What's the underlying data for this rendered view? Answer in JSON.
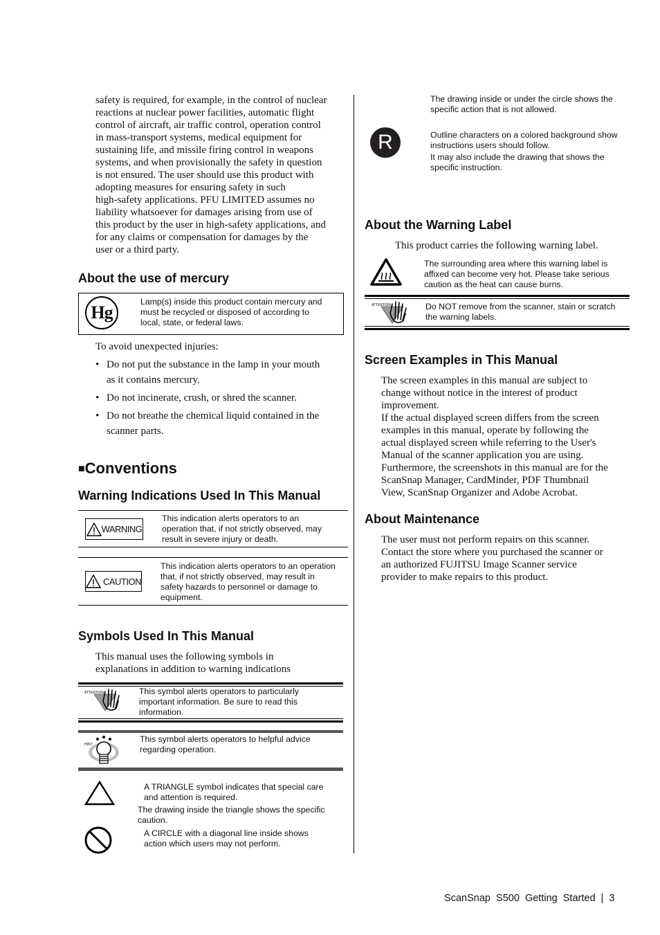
{
  "left": {
    "intro_paragraph": [
      "safety is required, for example, in the control of nuclear",
      "reactions at nuclear power facilities, automatic flight",
      "control of aircraft, air traffic control, operation control",
      "in mass-transport systems, medical equipment for",
      "sustaining life, and missile firing control in weapons",
      "systems, and when provisionally the safety in question",
      "is not ensured. The user should use this product with",
      "adopting measures for ensuring safety in such",
      "high-safety applications. PFU LIMITED assumes no",
      "liability whatsoever for damages arising from use of",
      "this product by the user in high-safety applications, and",
      "for any claims or compensation for damages by the",
      "user or a third party."
    ],
    "mercury": {
      "heading": "About the use of mercury",
      "icon_text": "Hg",
      "box_text": [
        "Lamp(s) inside this product contain mercury and",
        "must be recycled or disposed of according to",
        "local, state, or federal laws."
      ],
      "lead": "To avoid unexpected injuries:",
      "bullets": [
        [
          "Do not put the substance in the lamp in your mouth",
          "as it contains mercury."
        ],
        [
          "Do not incinerate, crush, or shred the scanner."
        ],
        [
          "Do not breathe the chemical liquid contained in the",
          "scanner parts."
        ]
      ]
    },
    "conventions": {
      "heading_marker": "■",
      "heading": "Conventions",
      "warning_section": {
        "heading": "Warning Indications Used In This Manual",
        "items": [
          {
            "label": "WARNING",
            "text": [
              "This indication alerts operators to an",
              "operation that, if not strictly observed, may",
              "result in severe injury or death."
            ]
          },
          {
            "label": "CAUTION",
            "text": [
              "This indication alerts operators to an operation",
              "that, if not strictly observed, may result in",
              "safety hazards to personnel or damage to",
              "equipment."
            ]
          }
        ]
      },
      "symbols_section": {
        "heading": "Symbols Used In This Manual",
        "intro": [
          "This manual uses the following symbols in",
          "explanations in addition to warning indications"
        ],
        "attention": {
          "icon_label": "ATTENTION",
          "text": [
            "This symbol alerts operators to particularly",
            "important information. Be sure to read this",
            "information."
          ]
        },
        "hint": {
          "icon_label": "HINT",
          "text": [
            "This symbol alerts operators to helpful advice",
            "regarding operation."
          ]
        },
        "triangle": {
          "text": [
            "A TRIANGLE symbol indicates that special care",
            "and attention is required."
          ],
          "followup": [
            "The drawing inside the triangle shows the specific",
            "caution."
          ]
        },
        "circle": {
          "text": [
            "A CIRCLE with a diagonal line inside shows",
            "action which users may not perform."
          ]
        }
      }
    }
  },
  "right": {
    "circle_followup": [
      "The drawing inside or under the circle shows the",
      "specific action that is not allowed."
    ],
    "instruction_symbol": {
      "icon_text": "R",
      "text": [
        "Outline characters on a colored background show",
        "instructions users should follow."
      ],
      "followup": [
        "It may also include the drawing that shows the",
        "specific instruction."
      ]
    },
    "warning_label": {
      "heading": "About the Warning Label",
      "lead": "This product carries the following warning label.",
      "hot_text": [
        "The surrounding area where this warning label is",
        "affixed can become very hot. Please take serious",
        "caution as the heat can cause burns."
      ],
      "attention_icon_label": "ATTENTION",
      "attention_text": [
        "Do NOT remove from the scanner, stain or scratch",
        "the warning labels."
      ]
    },
    "screen_examples": {
      "heading": "Screen Examples in This Manual",
      "paragraph": [
        "The screen examples in this manual are subject to",
        "change without notice in the interest of product",
        "improvement.",
        "If the actual displayed screen differs from the screen",
        "examples in this manual, operate by following the",
        "actual displayed screen while referring to the User's",
        "Manual of the scanner application you are using.",
        "Furthermore, the screenshots in this manual are for the",
        "ScanSnap Manager, CardMinder, PDF Thumbnail",
        "View, ScanSnap Organizer and Adobe Acrobat."
      ]
    },
    "maintenance": {
      "heading": "About Maintenance",
      "paragraph": [
        "The user must not perform repairs on this scanner.",
        "Contact the store where you purchased the scanner or",
        "an authorized FUJITSU Image Scanner service",
        "provider to make repairs to this product."
      ]
    }
  },
  "footer": {
    "title": "ScanSnap  S500  Getting  Started",
    "separator": "|",
    "page_number": "3"
  }
}
